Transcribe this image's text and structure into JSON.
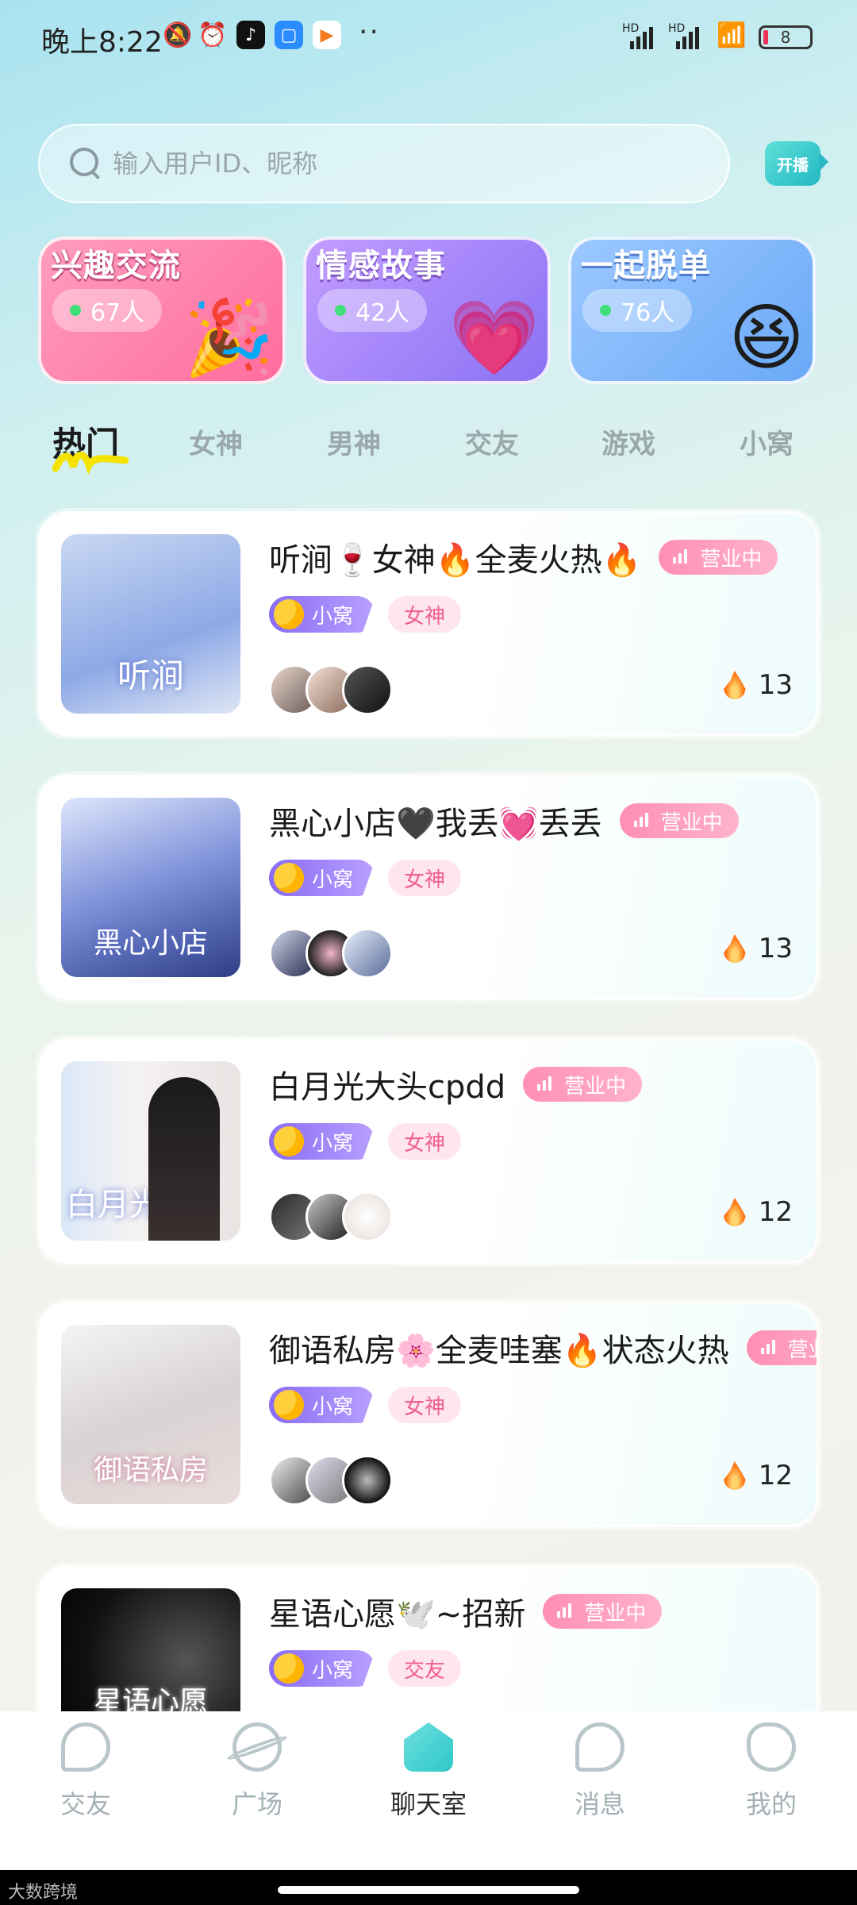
{
  "status_bar": {
    "time": "晚上8:22",
    "network_1": "HD",
    "network_2": "HD",
    "battery": "8"
  },
  "search": {
    "placeholder": "输入用户ID、昵称",
    "live_button": "开播"
  },
  "categories": [
    {
      "title": "兴趣交流",
      "count": "67人",
      "color_from": "#ff8fb3",
      "color_to": "#ff5f93",
      "icon": "party-popper"
    },
    {
      "title": "情感故事",
      "count": "42人",
      "color_from": "#b58bff",
      "color_to": "#7b66f2",
      "icon": "heart"
    },
    {
      "title": "一起脱单",
      "count": "76人",
      "color_from": "#7fb4ff",
      "color_to": "#5aa3f6",
      "icon": "chat-bubbles"
    }
  ],
  "tabs": [
    "热门",
    "女神",
    "男神",
    "交友",
    "游戏",
    "小窝"
  ],
  "rooms": [
    {
      "title": "听涧🍷女神🔥全麦火热🔥",
      "status": "营业中",
      "tag_nest": "小窝",
      "tag_type": "女神",
      "heat": "13",
      "cover_text": "听涧"
    },
    {
      "title": "黑心小店🖤我丢💓丢丢",
      "status": "营业中",
      "tag_nest": "小窝",
      "tag_type": "女神",
      "heat": "13",
      "cover_text": "黑心小店"
    },
    {
      "title": "白月光大头cpdd",
      "status": "营业中",
      "tag_nest": "小窝",
      "tag_type": "女神",
      "heat": "12",
      "cover_text": "白月光"
    },
    {
      "title": "御语私房🌸全麦哇塞🔥状态火热",
      "status": "营业中",
      "tag_nest": "小窝",
      "tag_type": "女神",
      "heat": "12",
      "cover_text": "御语私房"
    },
    {
      "title": "星语心愿🕊️~招新",
      "status": "营业中",
      "tag_nest": "小窝",
      "tag_type": "交友",
      "heat": "",
      "cover_text": "星语心愿"
    }
  ],
  "bottom_nav": [
    {
      "label": "交友",
      "icon": "heart-icon"
    },
    {
      "label": "广场",
      "icon": "planet-icon"
    },
    {
      "label": "聊天室",
      "icon": "home-icon"
    },
    {
      "label": "消息",
      "icon": "message-icon"
    },
    {
      "label": "我的",
      "icon": "profile-icon"
    }
  ],
  "watermark": "大数跨境",
  "colors": {
    "accent": "#2dc7c7",
    "badge_pink": "#ff8fb4",
    "nest_purple": "#8a6cf5"
  }
}
